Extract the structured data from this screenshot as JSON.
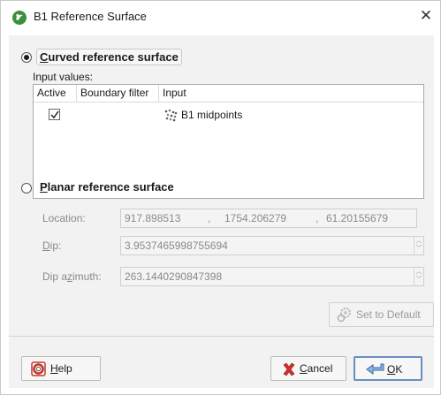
{
  "window": {
    "title": "B1 Reference Surface",
    "close_glyph": "✕",
    "icon": "app-logo-icon"
  },
  "curved": {
    "label_prefix": "C",
    "label_rest": "urved reference surface",
    "selected": true
  },
  "input_values_label": "Input values:",
  "table": {
    "columns": [
      "Active",
      "Boundary filter",
      "Input"
    ],
    "rows": [
      {
        "active": true,
        "boundary_filter": "",
        "input": "B1 midpoints",
        "icon": "points-icon"
      }
    ]
  },
  "planar": {
    "label_prefix": "P",
    "label_rest": "lanar reference surface",
    "selected": false
  },
  "fields": {
    "location_label": "Location:",
    "location_x": "917.898513",
    "location_y": "1754.206279",
    "location_z": "61.20155679",
    "dip_label_prefix": "D",
    "dip_label_rest": "ip:",
    "dip_value": "3.9537465998755694",
    "dip_azimuth_label_before": "Dip a",
    "dip_azimuth_label_u": "z",
    "dip_azimuth_label_after": "imuth:",
    "dip_azimuth_value": "263.1440290847398",
    "comma": ","
  },
  "buttons": {
    "set_default": "Set to Default",
    "help_prefix": "H",
    "help_rest": "elp",
    "cancel_prefix": "C",
    "cancel_rest": "ancel",
    "ok_prefix": "O",
    "ok_rest": "K"
  },
  "colors": {
    "accent": "#6a8fbf",
    "app_icon": "#3c8f3c",
    "cancel_icon": "#d0302a",
    "help_icon": "#c0392b"
  }
}
